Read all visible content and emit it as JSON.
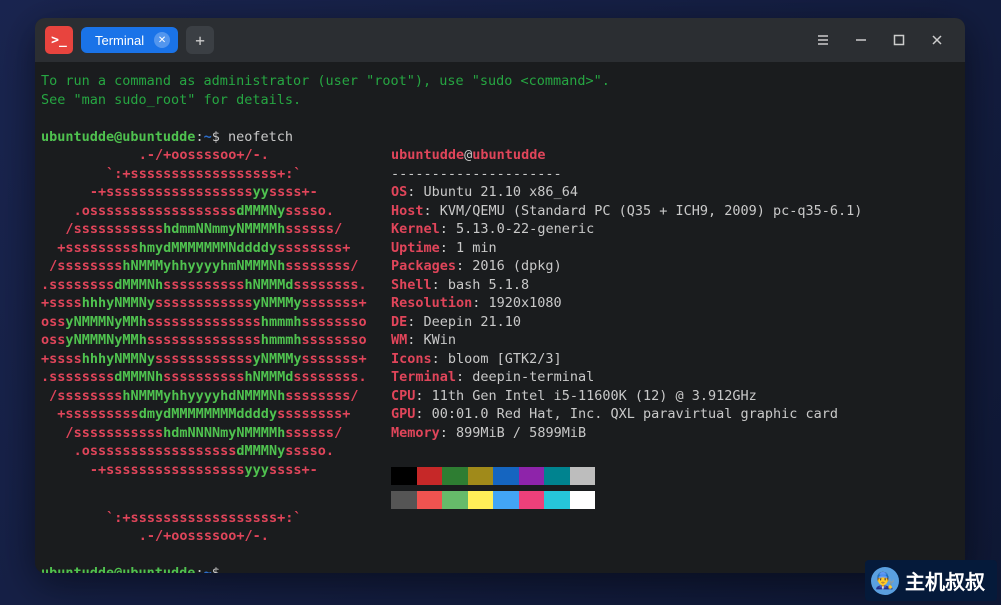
{
  "titlebar": {
    "tab_label": "Terminal"
  },
  "intro": {
    "line1": "To run a command as administrator (user \"root\"), use \"sudo <command>\".",
    "line2": "See \"man sudo_root\" for details."
  },
  "prompt": {
    "user": "ubuntudde@ubuntudde",
    "sep": ":",
    "path": "~",
    "end": "$",
    "command": "neofetch"
  },
  "nf": {
    "header_user": "ubuntudde",
    "header_at": "@",
    "header_host": "ubuntudde",
    "dashes": "---------------------",
    "os_l": "OS",
    "os_v": "Ubuntu 21.10 x86_64",
    "host_l": "Host",
    "host_v": "KVM/QEMU (Standard PC (Q35 + ICH9, 2009) pc-q35-6.1)",
    "kernel_l": "Kernel",
    "kernel_v": "5.13.0-22-generic",
    "uptime_l": "Uptime",
    "uptime_v": "1 min",
    "packages_l": "Packages",
    "packages_v": "2016 (dpkg)",
    "shell_l": "Shell",
    "shell_v": "bash 5.1.8",
    "res_l": "Resolution",
    "res_v": "1920x1080",
    "de_l": "DE",
    "de_v": "Deepin 21.10",
    "wm_l": "WM",
    "wm_v": "KWin",
    "icons_l": "Icons",
    "icons_v": "bloom [GTK2/3]",
    "term_l": "Terminal",
    "term_v": "deepin-terminal",
    "cpu_l": "CPU",
    "cpu_v": "11th Gen Intel i5-11600K (12) @ 3.912GHz",
    "gpu_l": "GPU",
    "gpu_v": "00:01.0 Red Hat, Inc. QXL paravirtual graphic card",
    "mem_l": "Memory",
    "mem_v": "899MiB / 5899MiB"
  },
  "logo": [
    "            .-/+oossssoo+/-.",
    "        `:+ssssssssssssssssss+:`",
    "      -+ssssssssssssssssssyyssss+-",
    "    .ossssssssssssssssssdMMMNysssso.",
    "   /ssssssssssshdmmNNmmyNMMMMhssssss/",
    "  +ssssssssshmydMMMMMMMNddddyssssssss+",
    " /sssssssshNMMMyhhyyyyhmNMMMNhssssssss/",
    ".ssssssssdMMMNhsssssssssshNMMMdssssssss.",
    "+sssshhhyNMMNyssssssssssssyNMMMysssssss+",
    "ossyNMMMNyMMhsssssssssssssshmmmhssssssso",
    "ossyNMMMNyMMhsssssssssssssshmmmhssssssso",
    "+sssshhhyNMMNyssssssssssssyNMMMysssssss+",
    ".ssssssssdMMMNhsssssssssshNMMMdssssssss.",
    " /sssssssshNMMMyhhyyyyhdNMMMNhssssssss/",
    "  +sssssssssdmydMMMMMMMMddddyssssssss+",
    "   /ssssssssssshdmNNNNmyNMMMMhssssss/",
    "    .ossssssssssssssssssdMMMNysssso.",
    "      -+sssssssssssssssssyyyssss+-",
    "        `:+ssssssssssssssssss+:`",
    "            .-/+oossssoo+/-."
  ],
  "palette_row1": [
    "#000000",
    "#c62828",
    "#2e7d32",
    "#a08a1a",
    "#1565c0",
    "#8e24aa",
    "#00838f",
    "#bdbdbd"
  ],
  "palette_row2": [
    "#555555",
    "#ef5350",
    "#66bb6a",
    "#ffee58",
    "#42a5f5",
    "#ec407a",
    "#26c6da",
    "#ffffff"
  ],
  "watermark": "主机叔叔"
}
